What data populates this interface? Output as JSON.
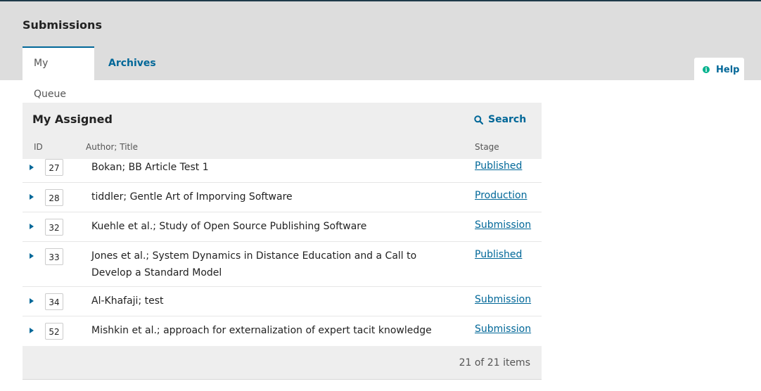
{
  "header": {
    "page_title": "Submissions",
    "tabs": [
      {
        "label": "My Queue",
        "active": true
      },
      {
        "label": "Archives",
        "active": false
      }
    ],
    "help_label": "Help"
  },
  "panel": {
    "title": "My Assigned",
    "search_label": "Search",
    "columns": {
      "id": "ID",
      "author_title": "Author; Title",
      "stage": "Stage"
    },
    "rows": [
      {
        "id": "27",
        "title": "Bokan; BB Article Test 1",
        "stage": "Published"
      },
      {
        "id": "28",
        "title": "tiddler; Gentle Art of Imporving Software",
        "stage": "Production"
      },
      {
        "id": "32",
        "title": "Kuehle et al.; Study of Open Source Publishing Software",
        "stage": "Submission"
      },
      {
        "id": "33",
        "title": "Jones et al.; System Dynamics in Distance Education and a Call to Develop a Standard Model",
        "stage": "Published"
      },
      {
        "id": "34",
        "title": "Al-Khafaji; test",
        "stage": "Submission"
      },
      {
        "id": "52",
        "title": "Mishkin et al.; approach for externalization of expert tacit knowledge",
        "stage": "Submission"
      }
    ],
    "count_text": "21 of 21 items"
  },
  "colors": {
    "accent": "#006798",
    "header_bg": "#dddddd",
    "panel_bg": "#eeeeee",
    "help_icon": "#00b28d"
  },
  "icons": {
    "help": "info-circle-icon",
    "search": "search-icon",
    "expander": "caret-right-icon"
  }
}
